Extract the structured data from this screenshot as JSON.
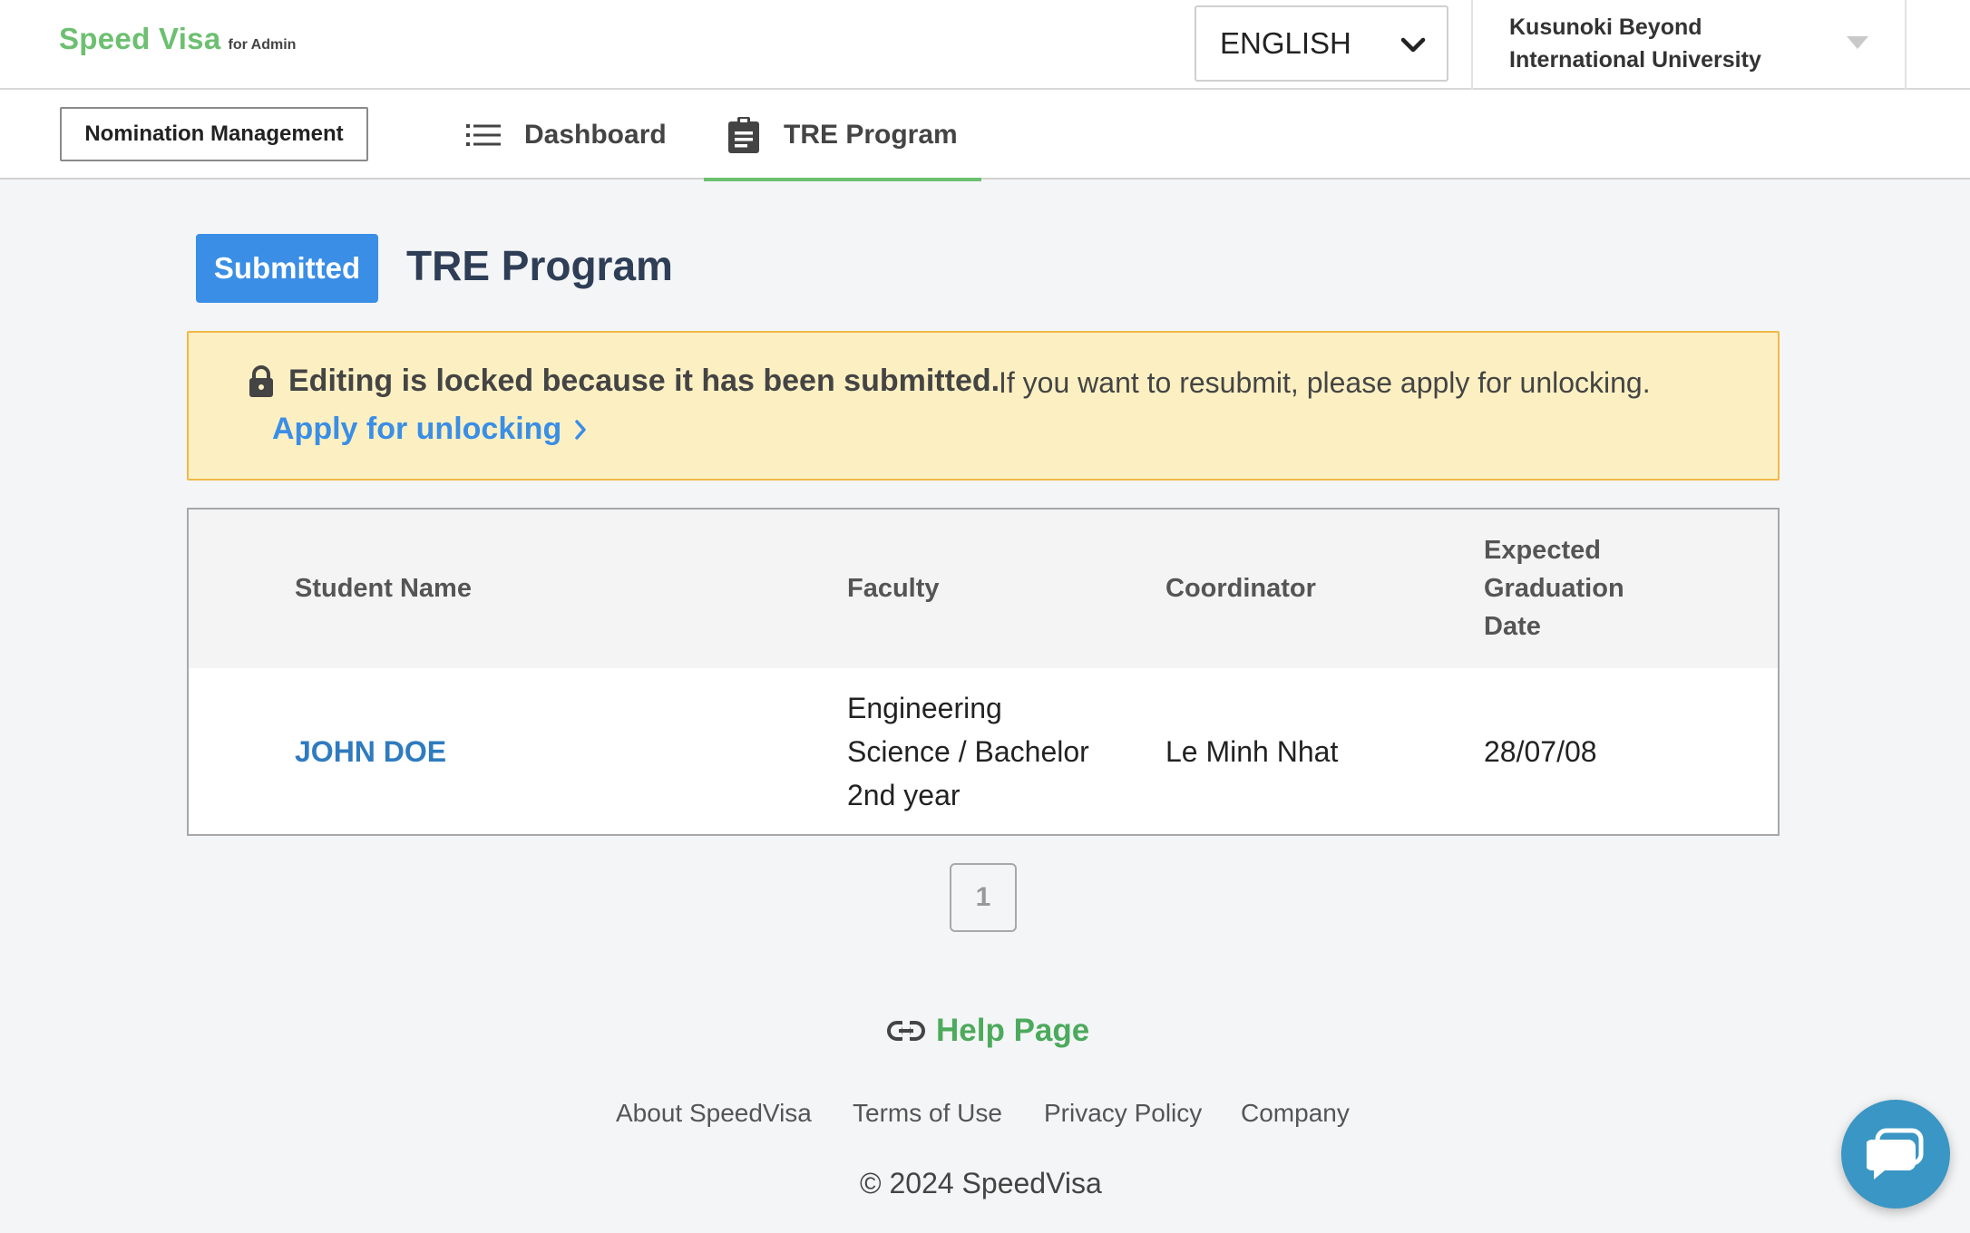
{
  "header": {
    "brand": "Speed Visa",
    "brand_sub": "for Admin",
    "language": "ENGLISH",
    "university_line1": "Kusunoki Beyond",
    "university_line2": "International University"
  },
  "nav": {
    "nomination_button": "Nomination Management",
    "tabs": [
      {
        "label": "Dashboard",
        "icon": "list-icon",
        "active": false
      },
      {
        "label": "TRE Program",
        "icon": "clipboard-icon",
        "active": true
      }
    ],
    "active_color": "#6cc070"
  },
  "page": {
    "status_badge": "Submitted",
    "title": "TRE Program",
    "badge_color": "#3a8ee6"
  },
  "alert": {
    "strong_text": "Editing is locked because it has been submitted.",
    "normal_text": "If you want to resubmit, please apply for unlocking.",
    "link_text": "Apply for unlocking",
    "icon": "lock-icon"
  },
  "table": {
    "headers": {
      "student_name": "Student Name",
      "faculty": "Faculty",
      "coordinator": "Coordinator",
      "graduation_line1": "Expected",
      "graduation_line2": "Graduation",
      "graduation_line3": "Date"
    },
    "rows": [
      {
        "student_name": "JOHN DOE",
        "faculty_line1": "Engineering",
        "faculty_line2": "Science / Bachelor",
        "faculty_line3": "2nd year",
        "coordinator": "Le Minh Nhat",
        "graduation_date": "28/07/08"
      }
    ]
  },
  "pagination": {
    "current_page": "1"
  },
  "footer": {
    "help_link": "Help Page",
    "links": [
      "About SpeedVisa",
      "Terms of Use",
      "Privacy Policy",
      "Company"
    ],
    "copyright": "© 2024 SpeedVisa"
  },
  "chat": {
    "icon": "chat-bubble-icon"
  }
}
